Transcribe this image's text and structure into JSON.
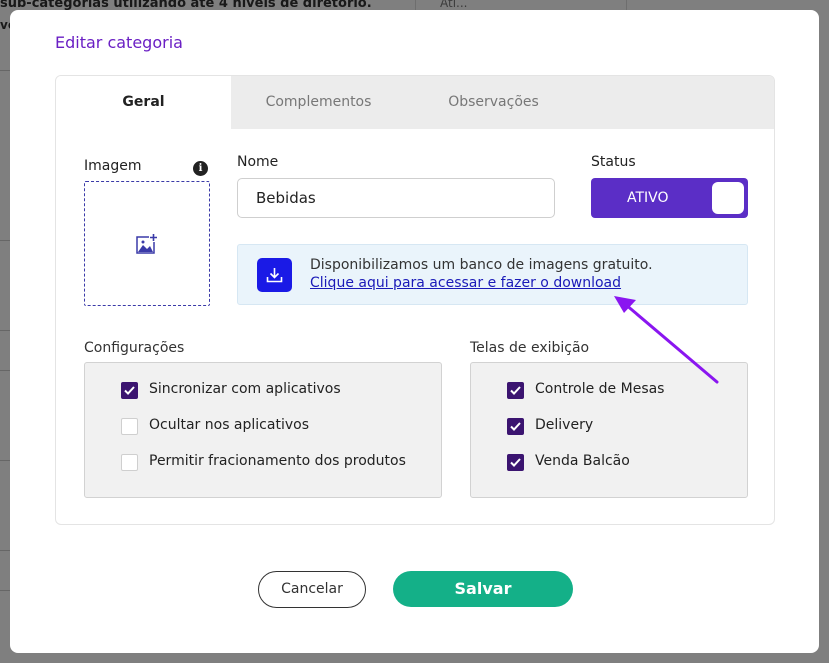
{
  "background": {
    "text_line1": "sub-categorias utilizando até 4 níveis de diretório.",
    "text_line2": "ve",
    "column_label": "Ati..."
  },
  "modal": {
    "title": "Editar categoria",
    "tabs": [
      {
        "label": "Geral",
        "active": true
      },
      {
        "label": "Complementos",
        "active": false
      },
      {
        "label": "Observações",
        "active": false
      }
    ],
    "image": {
      "label": "Imagem",
      "info_icon": "info-icon",
      "placeholder_icon": "add-image-icon"
    },
    "name": {
      "label": "Nome",
      "value": "Bebidas"
    },
    "status": {
      "label": "Status",
      "value": "ATIVO",
      "on": true
    },
    "banner": {
      "text": "Disponibilizamos um banco de imagens gratuito.",
      "link": "Clique aqui para acessar e fazer o download",
      "icon": "download-icon"
    },
    "configuracoes": {
      "label": "Configurações",
      "items": [
        {
          "label": "Sincronizar com aplicativos",
          "checked": true
        },
        {
          "label": "Ocultar nos aplicativos",
          "checked": false
        },
        {
          "label": "Permitir fracionamento dos produtos",
          "checked": false
        }
      ]
    },
    "telas": {
      "label": "Telas de exibição",
      "items": [
        {
          "label": "Controle de Mesas",
          "checked": true
        },
        {
          "label": "Delivery",
          "checked": true
        },
        {
          "label": "Venda Balcão",
          "checked": true
        }
      ]
    },
    "buttons": {
      "cancel": "Cancelar",
      "save": "Salvar"
    }
  },
  "colors": {
    "accent": "#5b2ec6",
    "title": "#6a1fc4",
    "save": "#14b088",
    "checkbox": "#3b1470",
    "arrow": "#8a16f0"
  }
}
